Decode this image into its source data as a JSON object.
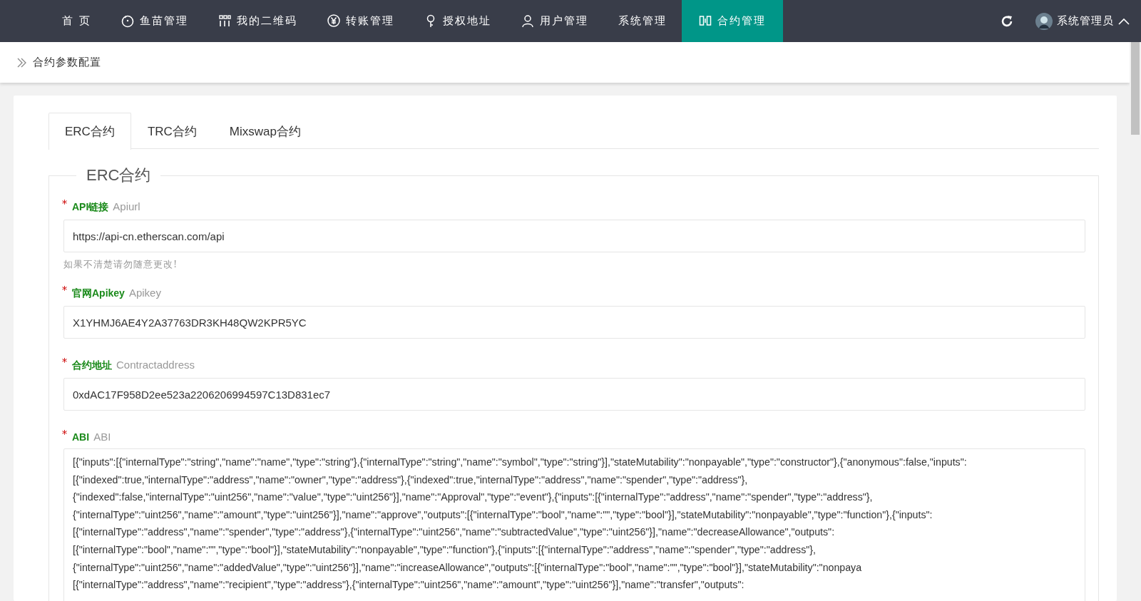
{
  "nav": {
    "items": [
      {
        "label": "首 页",
        "selected": false
      },
      {
        "label": "鱼苗管理",
        "selected": false
      },
      {
        "label": "我的二维码",
        "selected": false
      },
      {
        "label": "转账管理",
        "selected": false
      },
      {
        "label": "授权地址",
        "selected": false
      },
      {
        "label": "用户管理",
        "selected": false
      },
      {
        "label": "系统管理",
        "selected": false
      },
      {
        "label": "合约管理",
        "selected": true
      }
    ],
    "user": "系统管理员"
  },
  "breadcrumb": "合约参数配置",
  "tabs": [
    {
      "label": "ERC合约",
      "selected": true
    },
    {
      "label": "TRC合约",
      "selected": false
    },
    {
      "label": "Mixswap合约",
      "selected": false
    }
  ],
  "section_title": "ERC合约",
  "fields": [
    {
      "kind": "input",
      "required_mark": "*",
      "label": "API链接",
      "sublabel": "Apiurl",
      "value": "https://api-cn.etherscan.com/api",
      "hint": "如果不清楚请勿随意更改!"
    },
    {
      "kind": "input",
      "required_mark": "*",
      "label": "官网Apikey",
      "sublabel": "Apikey",
      "value": "X1YHMJ6AE4Y2A37763DR3KH48QW2KPR5YC"
    },
    {
      "kind": "input",
      "required_mark": "*",
      "label": "合约地址",
      "sublabel": "Contractaddress",
      "value": "0xdAC17F958D2ee523a2206206994597C13D831ec7"
    },
    {
      "kind": "textarea",
      "required_mark": "*",
      "label": "ABI",
      "sublabel": "ABI",
      "lines": [
        "[{\"inputs\":[{\"internalType\":\"string\",\"name\":\"name\",\"type\":\"string\"},{\"internalType\":\"string\",\"name\":\"symbol\",\"type\":\"string\"}],\"stateMutability\":\"nonpayable\",\"type\":\"constructor\"},{\"anonymous\":false,\"inputs\":",
        "[{\"indexed\":true,\"internalType\":\"address\",\"name\":\"owner\",\"type\":\"address\"},{\"indexed\":true,\"internalType\":\"address\",\"name\":\"spender\",\"type\":\"address\"},",
        "{\"indexed\":false,\"internalType\":\"uint256\",\"name\":\"value\",\"type\":\"uint256\"}],\"name\":\"Approval\",\"type\":\"event\"},{\"inputs\":[{\"internalType\":\"address\",\"name\":\"spender\",\"type\":\"address\"},",
        "{\"internalType\":\"uint256\",\"name\":\"amount\",\"type\":\"uint256\"}],\"name\":\"approve\",\"outputs\":[{\"internalType\":\"bool\",\"name\":\"\",\"type\":\"bool\"}],\"stateMutability\":\"nonpayable\",\"type\":\"function\"},{\"inputs\":",
        "[{\"internalType\":\"address\",\"name\":\"spender\",\"type\":\"address\"},{\"internalType\":\"uint256\",\"name\":\"subtractedValue\",\"type\":\"uint256\"}],\"name\":\"decreaseAllowance\",\"outputs\":",
        "[{\"internalType\":\"bool\",\"name\":\"\",\"type\":\"bool\"}],\"stateMutability\":\"nonpayable\",\"type\":\"function\"},{\"inputs\":[{\"internalType\":\"address\",\"name\":\"spender\",\"type\":\"address\"},",
        "{\"internalType\":\"uint256\",\"name\":\"addedValue\",\"type\":\"uint256\"}],\"name\":\"increaseAllowance\",\"outputs\":[{\"internalType\":\"bool\",\"name\":\"\",\"type\":\"bool\"}],\"stateMutability\":\"nonpaya",
        "[{\"internalType\":\"address\",\"name\":\"recipient\",\"type\":\"address\"},{\"internalType\":\"uint256\",\"name\":\"amount\",\"type\":\"uint256\"}],\"name\":\"transfer\",\"outputs\":"
      ]
    }
  ]
}
